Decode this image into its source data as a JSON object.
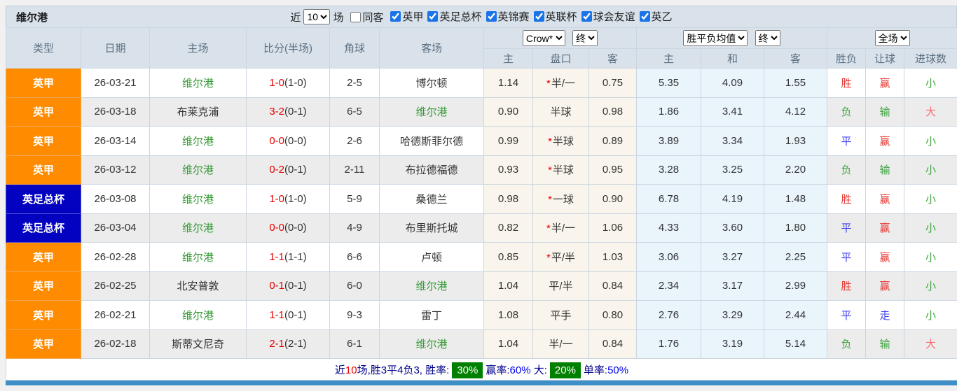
{
  "toolbar": {
    "team_title": "维尔港",
    "recent_label": "近",
    "recent_value": "10",
    "matches_label": "场",
    "same_away_label": "同客",
    "same_away_checked": false,
    "leagues": [
      {
        "label": "英甲",
        "checked": true
      },
      {
        "label": "英足总杯",
        "checked": true
      },
      {
        "label": "英锦赛",
        "checked": true
      },
      {
        "label": "英联杯",
        "checked": true
      },
      {
        "label": "球会友谊",
        "checked": true
      },
      {
        "label": "英乙",
        "checked": true
      }
    ]
  },
  "table": {
    "headers": [
      "类型",
      "日期",
      "主场",
      "比分(半场)",
      "角球",
      "客场"
    ],
    "selects": {
      "odds_company": "Crow*",
      "odds_time": "终",
      "avg_name": "胜平负均值",
      "avg_time": "终",
      "scope": "全场"
    },
    "sub_headers": [
      "主",
      "盘口",
      "客",
      "主",
      "和",
      "客",
      "胜负",
      "让球",
      "进球数"
    ],
    "rows": [
      {
        "league": "英甲",
        "league_color": "orange",
        "date": "26-03-21",
        "home": "维尔港",
        "home_self": true,
        "score": "1-0",
        "half": "1-0",
        "corner": "2-5",
        "away": "博尔顿",
        "away_self": false,
        "o1": "1.14",
        "star": true,
        "handicap": "半/一",
        "o2": "0.75",
        "a1": "5.35",
        "a2": "4.09",
        "a3": "1.55",
        "res": [
          [
            "胜",
            "r"
          ],
          [
            "赢",
            "r"
          ],
          [
            "小",
            "g"
          ]
        ]
      },
      {
        "league": "英甲",
        "league_color": "orange",
        "date": "26-03-18",
        "home": "布莱克浦",
        "home_self": false,
        "score": "3-2",
        "half": "0-1",
        "corner": "6-5",
        "away": "维尔港",
        "away_self": true,
        "o1": "0.90",
        "star": false,
        "handicap": "半球",
        "o2": "0.98",
        "a1": "1.86",
        "a2": "3.41",
        "a3": "4.12",
        "res": [
          [
            "负",
            "g"
          ],
          [
            "输",
            "g"
          ],
          [
            "大",
            "rl"
          ]
        ]
      },
      {
        "league": "英甲",
        "league_color": "orange",
        "date": "26-03-14",
        "home": "维尔港",
        "home_self": true,
        "score": "0-0",
        "half": "0-0",
        "corner": "2-6",
        "away": "哈德斯菲尔德",
        "away_self": false,
        "o1": "0.99",
        "star": true,
        "handicap": "半球",
        "o2": "0.89",
        "a1": "3.89",
        "a2": "3.34",
        "a3": "1.93",
        "res": [
          [
            "平",
            "b"
          ],
          [
            "赢",
            "r"
          ],
          [
            "小",
            "g"
          ]
        ]
      },
      {
        "league": "英甲",
        "league_color": "orange",
        "date": "26-03-12",
        "home": "维尔港",
        "home_self": true,
        "score": "0-2",
        "half": "0-1",
        "corner": "2-11",
        "away": "布拉德福德",
        "away_self": false,
        "o1": "0.93",
        "star": true,
        "handicap": "半球",
        "o2": "0.95",
        "a1": "3.28",
        "a2": "3.25",
        "a3": "2.20",
        "res": [
          [
            "负",
            "g"
          ],
          [
            "输",
            "g"
          ],
          [
            "小",
            "g"
          ]
        ]
      },
      {
        "league": "英足总杯",
        "league_color": "blue",
        "date": "26-03-08",
        "home": "维尔港",
        "home_self": true,
        "score": "1-0",
        "half": "1-0",
        "corner": "5-9",
        "away": "桑德兰",
        "away_self": false,
        "o1": "0.98",
        "star": true,
        "handicap": "一球",
        "o2": "0.90",
        "a1": "6.78",
        "a2": "4.19",
        "a3": "1.48",
        "res": [
          [
            "胜",
            "r"
          ],
          [
            "赢",
            "r"
          ],
          [
            "小",
            "g"
          ]
        ]
      },
      {
        "league": "英足总杯",
        "league_color": "blue",
        "date": "26-03-04",
        "home": "维尔港",
        "home_self": true,
        "score": "0-0",
        "half": "0-0",
        "corner": "4-9",
        "away": "布里斯托城",
        "away_self": false,
        "o1": "0.82",
        "star": true,
        "handicap": "半/一",
        "o2": "1.06",
        "a1": "4.33",
        "a2": "3.60",
        "a3": "1.80",
        "res": [
          [
            "平",
            "b"
          ],
          [
            "赢",
            "r"
          ],
          [
            "小",
            "g"
          ]
        ]
      },
      {
        "league": "英甲",
        "league_color": "orange",
        "date": "26-02-28",
        "home": "维尔港",
        "home_self": true,
        "score": "1-1",
        "half": "1-1",
        "corner": "6-6",
        "away": "卢顿",
        "away_self": false,
        "o1": "0.85",
        "star": true,
        "handicap": "平/半",
        "o2": "1.03",
        "a1": "3.06",
        "a2": "3.27",
        "a3": "2.25",
        "res": [
          [
            "平",
            "b"
          ],
          [
            "赢",
            "r"
          ],
          [
            "小",
            "g"
          ]
        ]
      },
      {
        "league": "英甲",
        "league_color": "orange",
        "date": "26-02-25",
        "home": "北安普敦",
        "home_self": false,
        "score": "0-1",
        "half": "0-1",
        "corner": "6-0",
        "away": "维尔港",
        "away_self": true,
        "o1": "1.04",
        "star": false,
        "handicap": "平/半",
        "o2": "0.84",
        "a1": "2.34",
        "a2": "3.17",
        "a3": "2.99",
        "res": [
          [
            "胜",
            "r"
          ],
          [
            "赢",
            "r"
          ],
          [
            "小",
            "g"
          ]
        ]
      },
      {
        "league": "英甲",
        "league_color": "orange",
        "date": "26-02-21",
        "home": "维尔港",
        "home_self": true,
        "score": "1-1",
        "half": "0-1",
        "corner": "9-3",
        "away": "雷丁",
        "away_self": false,
        "o1": "1.08",
        "star": false,
        "handicap": "平手",
        "o2": "0.80",
        "a1": "2.76",
        "a2": "3.29",
        "a3": "2.44",
        "res": [
          [
            "平",
            "b"
          ],
          [
            "走",
            "b"
          ],
          [
            "小",
            "g"
          ]
        ]
      },
      {
        "league": "英甲",
        "league_color": "orange",
        "date": "26-02-18",
        "home": "斯蒂文尼奇",
        "home_self": false,
        "score": "2-1",
        "half": "2-1",
        "corner": "6-1",
        "away": "维尔港",
        "away_self": true,
        "o1": "1.04",
        "star": false,
        "handicap": "半/一",
        "o2": "0.84",
        "a1": "1.76",
        "a2": "3.19",
        "a3": "5.14",
        "res": [
          [
            "负",
            "g"
          ],
          [
            "输",
            "g"
          ],
          [
            "大",
            "rl"
          ]
        ]
      }
    ]
  },
  "footer": {
    "segments": [
      {
        "text": "近",
        "style": "navy"
      },
      {
        "text": "10",
        "style": "red"
      },
      {
        "text": "场,胜3平4负3, 胜率:",
        "style": "navy"
      },
      {
        "text": "30%",
        "style": "greenbox"
      },
      {
        "text": "赢率:",
        "style": "navy"
      },
      {
        "text": "60%",
        "style": "blue"
      },
      {
        "text": " 大:",
        "style": "navy"
      },
      {
        "text": "20%",
        "style": "greenbox"
      },
      {
        "text": "单率:",
        "style": "navy"
      },
      {
        "text": "50%",
        "style": "blue"
      }
    ]
  },
  "colors": {
    "header_bg": "#d9e2eb",
    "league_one_bg": "#ff8c00",
    "fa_cup_bg": "#0202c0",
    "self_team_green": "#339933",
    "score_red": "#e60000",
    "win_red": "#e53935",
    "lose_green": "#3fa33f",
    "draw_blue": "#4545ee",
    "big_red": "#ff6b6b",
    "odds_col_bg": "#faf5ec",
    "avg_col_bg": "#eaf4fb",
    "stat_box_green": "#008000",
    "bottom_bar_blue": "#3e8ec7"
  }
}
